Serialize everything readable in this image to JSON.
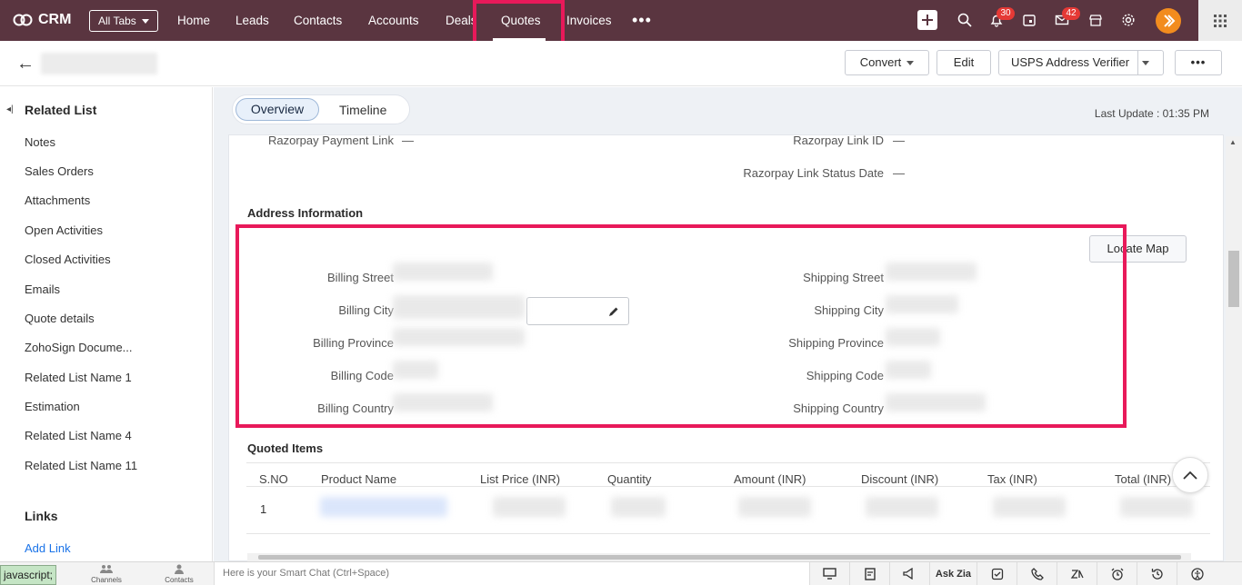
{
  "topnav": {
    "app_name": "CRM",
    "all_tabs": "All Tabs",
    "items": [
      "Home",
      "Leads",
      "Contacts",
      "Accounts",
      "Deals",
      "Quotes",
      "Invoices"
    ],
    "more": "•••",
    "notif_count": "30",
    "mail_count": "42"
  },
  "record": {
    "back": "←",
    "convert": "Convert",
    "edit": "Edit",
    "usps": "USPS Address Verifier",
    "more": "•••"
  },
  "sidebar": {
    "title": "Related List",
    "items": [
      "Notes",
      "Sales Orders",
      "Attachments",
      "Open Activities",
      "Closed Activities",
      "Emails",
      "Quote details",
      "ZohoSign Docume...",
      "Related List Name 1",
      "Estimation",
      "Related List Name 4",
      "Related List Name 11"
    ],
    "links_title": "Links",
    "add_link": "Add Link"
  },
  "tabs": {
    "overview": "Overview",
    "timeline": "Timeline"
  },
  "last_update": "Last Update : 01:35 PM",
  "fields": {
    "razorpay_payment_link": "Razorpay Payment Link",
    "razorpay_link_id": "Razorpay Link ID",
    "razorpay_link_status_date": "Razorpay Link Status Date",
    "empty": "—"
  },
  "address": {
    "title": "Address Information",
    "locate_map": "Locate Map",
    "billing": [
      "Billing Street",
      "Billing City",
      "Billing Province",
      "Billing Code",
      "Billing Country"
    ],
    "shipping": [
      "Shipping Street",
      "Shipping City",
      "Shipping Province",
      "Shipping Code",
      "Shipping Country"
    ]
  },
  "quoted_items": {
    "title": "Quoted Items",
    "columns": [
      "S.NO",
      "Product Name",
      "List Price (INR)",
      "Quantity",
      "Amount (INR)",
      "Discount (INR)",
      "Tax (INR)",
      "Total (INR)"
    ],
    "rows": [
      {
        "sno": "1"
      }
    ]
  },
  "bottombar": {
    "status": "javascript;",
    "channels": "Channels",
    "contacts": "Contacts",
    "smartchat_placeholder": "Here is your Smart Chat (Ctrl+Space)",
    "ask_zia": "Ask Zia"
  }
}
